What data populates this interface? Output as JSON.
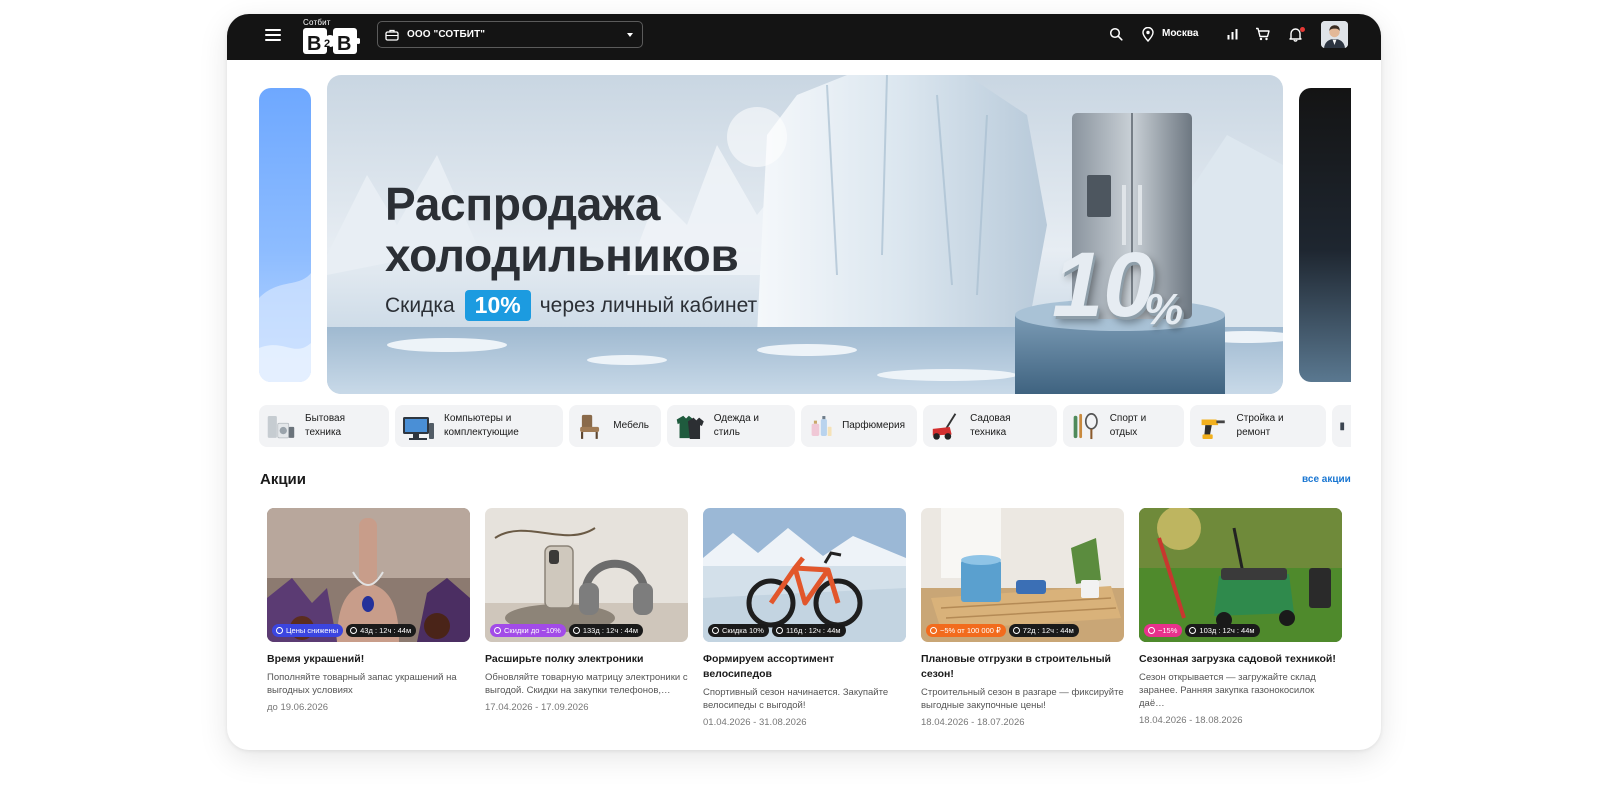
{
  "header": {
    "logo_caption": "Сотбит",
    "logo_text": "B2B",
    "company": "ООО \"СОТБИТ\"",
    "city": "Москва"
  },
  "banner": {
    "title_line1": "Распродажа",
    "title_line2": "холодильников",
    "sub_before": "Скидка",
    "badge": "10%",
    "sub_after": "через личный кабинет",
    "overlay_big": "10",
    "overlay_pct": "%"
  },
  "categories": [
    {
      "label": "Бытовая техника",
      "icon": "appliances-icon"
    },
    {
      "label": "Компьютеры и комплектующие",
      "icon": "computer-icon"
    },
    {
      "label": "Мебель",
      "icon": "furniture-icon"
    },
    {
      "label": "Одежда и стиль",
      "icon": "clothes-icon"
    },
    {
      "label": "Парфюмерия",
      "icon": "perfume-icon"
    },
    {
      "label": "Садовая техника",
      "icon": "lawnmower-icon"
    },
    {
      "label": "Спорт и отдых",
      "icon": "sport-icon"
    },
    {
      "label": "Стройка и ремонт",
      "icon": "drill-icon"
    }
  ],
  "promos": {
    "title": "Акции",
    "all_link": "все акции",
    "cards": [
      {
        "badge": "Цены снижены",
        "badge_color": "#3b45e0",
        "timer": "43д : 12ч : 44м",
        "title": "Время украшений!",
        "desc": "Пополняйте товарный запас украшений на выгодных условиях",
        "dates": "до 19.06.2026"
      },
      {
        "badge": "Скидки до −10%",
        "badge_color": "#a24be8",
        "timer": "133д : 12ч : 44м",
        "title": "Расширьте полку электроники",
        "desc": "Обновляйте товарную матрицу электроники с выгодой. Скидки на закупки телефонов,…",
        "dates": "17.04.2026 - 17.09.2026"
      },
      {
        "badge": "Скидка 10%",
        "badge_color": "#1a1a1a",
        "timer": "116д : 12ч : 44м",
        "title": "Формируем ассортимент велосипедов",
        "desc": "Спортивный сезон начинается. Закупайте велосипеды с выгодой!",
        "dates": "01.04.2026 - 31.08.2026"
      },
      {
        "badge": "−5% от 100 000 ₽",
        "badge_color": "#f26b1d",
        "timer": "72д : 12ч : 44м",
        "title": "Плановые отгрузки в строительный сезон!",
        "desc": "Строительный сезон в разгаре — фиксируйте выгодные закупочные цены!",
        "dates": "18.04.2026 - 18.07.2026"
      },
      {
        "badge": "−15%",
        "badge_color": "#e8318c",
        "timer": "103д : 12ч : 44м",
        "title": "Сезонная загрузка садовой техникой!",
        "desc": "Сезон открывается — загружайте склад заранее. Ранняя закупка газонокосилок даё…",
        "dates": "18.04.2026 - 18.08.2026"
      }
    ]
  }
}
